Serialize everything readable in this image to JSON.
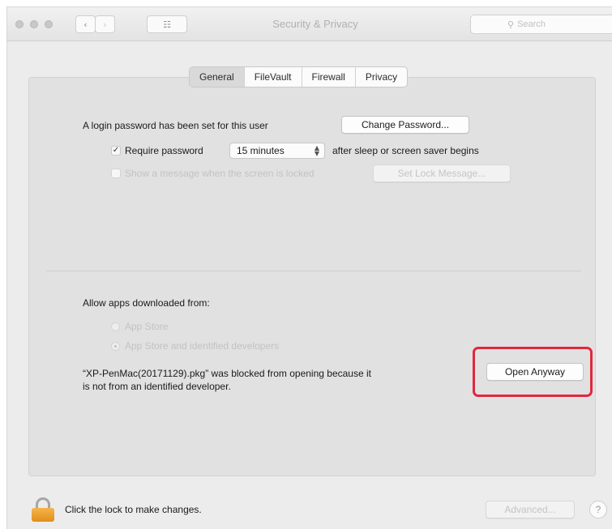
{
  "window": {
    "title": "Security & Privacy",
    "grid_label": "☷",
    "back_label": "‹",
    "forward_label": "›",
    "search_placeholder": "Search"
  },
  "tabs": [
    {
      "label": "General",
      "active": true
    },
    {
      "label": "FileVault",
      "active": false
    },
    {
      "label": "Firewall",
      "active": false
    },
    {
      "label": "Privacy",
      "active": false
    }
  ],
  "general": {
    "login_password_text": "A login password has been set for this user",
    "change_password_label": "Change Password...",
    "require_password": {
      "checked": true,
      "label": "Require password",
      "selected_interval": "15 minutes",
      "suffix": "after sleep or screen saver begins"
    },
    "show_message": {
      "checked": false,
      "label": "Show a message when the screen is locked",
      "button_label": "Set Lock Message..."
    }
  },
  "allow_apps": {
    "heading": "Allow apps downloaded from:",
    "options": [
      {
        "label": "App Store",
        "selected": false
      },
      {
        "label": "App Store and identified developers",
        "selected": true
      }
    ],
    "blocked_message_line1": "“XP-PenMac(20171129).pkg” was blocked from opening because it",
    "blocked_message_line2": "is not from an identified developer.",
    "open_anyway_label": "Open Anyway"
  },
  "footer": {
    "lock_text": "Click the lock to make changes.",
    "advanced_label": "Advanced...",
    "help_label": "?"
  },
  "colors": {
    "highlight": "#e0283e",
    "lock": "#e08f1c"
  }
}
